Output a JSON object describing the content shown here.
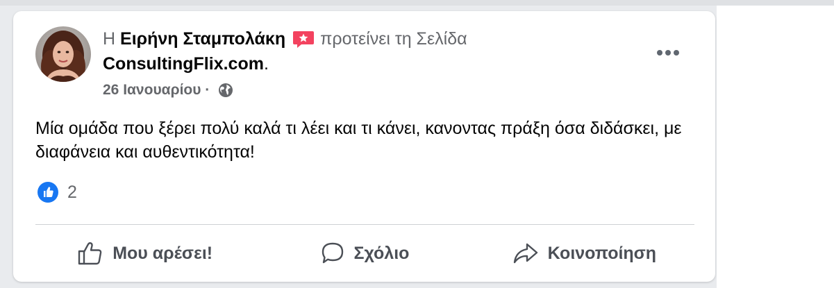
{
  "post": {
    "prefix": "Η",
    "author": "Ειρήνη Σταμπολάκη",
    "badge_icon": "recommendation-badge-icon",
    "recommends_text": "προτείνει τη Σελίδα",
    "page_name": "ConsultingFlix.com",
    "page_suffix": ".",
    "date": "26 Ιανουαρίου",
    "date_separator": " · ",
    "privacy_icon": "globe-icon",
    "more_icon": "more-options-icon",
    "body": "Μία ομάδα που ξέρει πολύ καλά τι λέει και τι κάνει, κανοντας πράξη όσα διδάσκει, με διαφάνεια και αυθεντικότητα!"
  },
  "reactions": {
    "icon": "like-reaction-icon",
    "count": "2"
  },
  "actions": {
    "like_label": "Μου αρέσει!",
    "comment_label": "Σχόλιο",
    "share_label": "Κοινοποίηση"
  },
  "colors": {
    "like_blue": "#1877f2",
    "badge_red": "#f3425f",
    "secondary_text": "#65676b",
    "primary_text": "#050505"
  }
}
